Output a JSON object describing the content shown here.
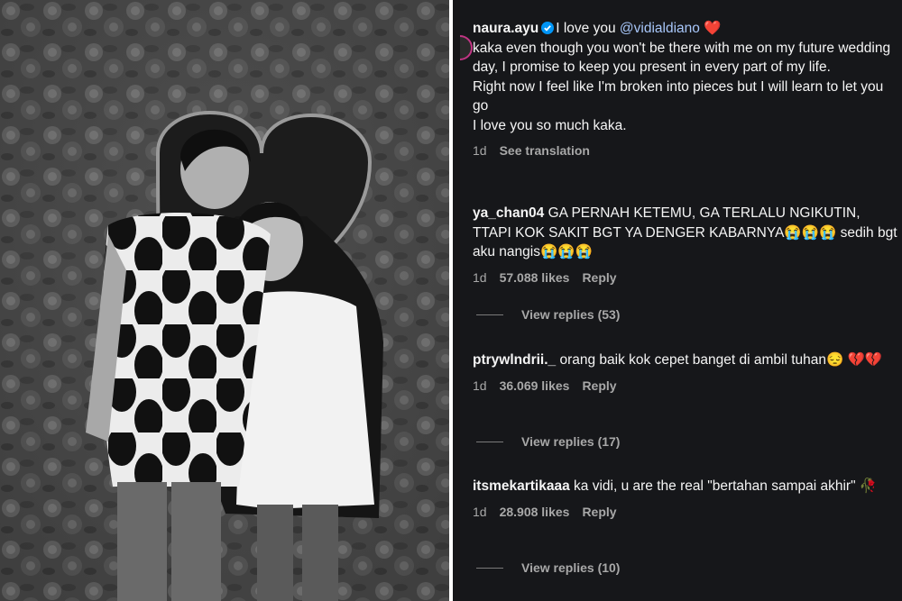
{
  "comments": [
    {
      "username": "naura.ayu",
      "verified": true,
      "text_before_mention": "I love you ",
      "mention": "@vidialdiano",
      "text_after_mention": " ❤️",
      "body": "kaka even though you won't be there with me on my future wedding day, I promise to keep you present in every part of my life.\nRight now I feel like I'm broken into pieces but I will learn to let you go\nI love you so much kaka.",
      "age": "1d",
      "action": "See translation"
    },
    {
      "username": "ya_chan04",
      "text": "GA PERNAH KETEMU, GA TERLALU NGIKUTIN, TTAPI KOK SAKIT BGT YA DENGER KABARNYA😭😭😭 sedih bgt aku nangis😭😭😭",
      "age": "1d",
      "likes": "57.088 likes",
      "reply_label": "Reply",
      "view_replies": "View replies (53)"
    },
    {
      "username": "ptrywlndrii._",
      "text": "orang baik kok cepet banget di ambil tuhan😔 💔💔",
      "age": "1d",
      "likes": "36.069 likes",
      "reply_label": "Reply",
      "view_replies": "View replies (17)"
    },
    {
      "username": "itsmekartikaaa",
      "text": "ka vidi, u are the real \"bertahan sampai akhir\" 🥀",
      "age": "1d",
      "likes": "28.908 likes",
      "reply_label": "Reply",
      "view_replies": "View replies (10)"
    }
  ],
  "colors": {
    "panel_bg": "#16171a",
    "mention": "#a8c7fa",
    "verified_badge": "#0095f6",
    "muted": "#a8a8a8"
  },
  "icons": [
    "verified-badge-icon",
    "avatar"
  ]
}
